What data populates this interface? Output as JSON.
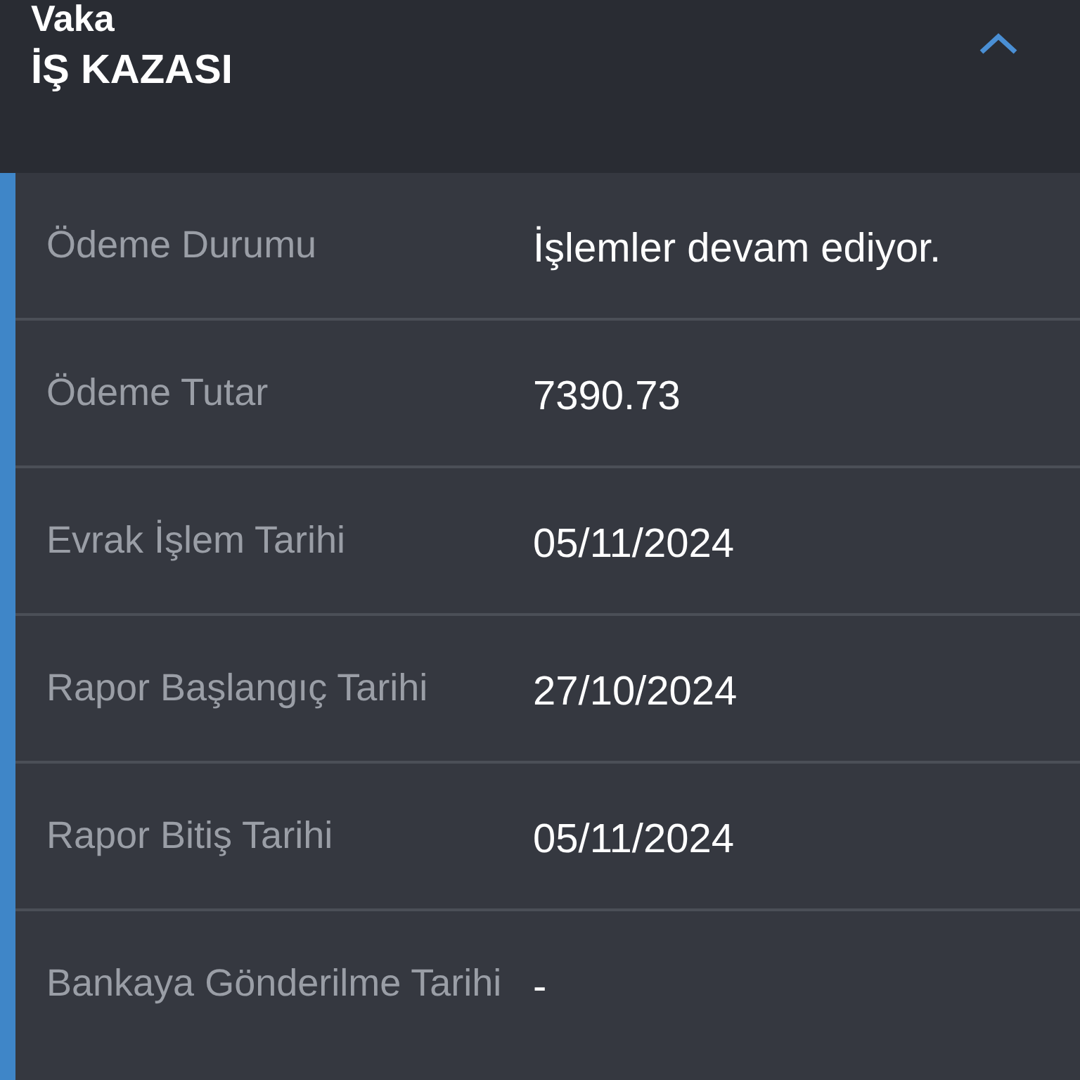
{
  "header": {
    "subtitle": "Vaka",
    "title": "İŞ KAZASI",
    "expanded": true
  },
  "rows": [
    {
      "label": "Ödeme Durumu",
      "value": "İşlemler devam ediyor."
    },
    {
      "label": "Ödeme Tutar",
      "value": "7390.73"
    },
    {
      "label": "Evrak İşlem Tarihi",
      "value": "05/11/2024"
    },
    {
      "label": "Rapor Başlangıç Tarihi",
      "value": "27/10/2024"
    },
    {
      "label": "Rapor Bitiş Tarihi",
      "value": "05/11/2024"
    },
    {
      "label": "Bankaya Gönderilme Tarihi",
      "value": "-"
    }
  ]
}
